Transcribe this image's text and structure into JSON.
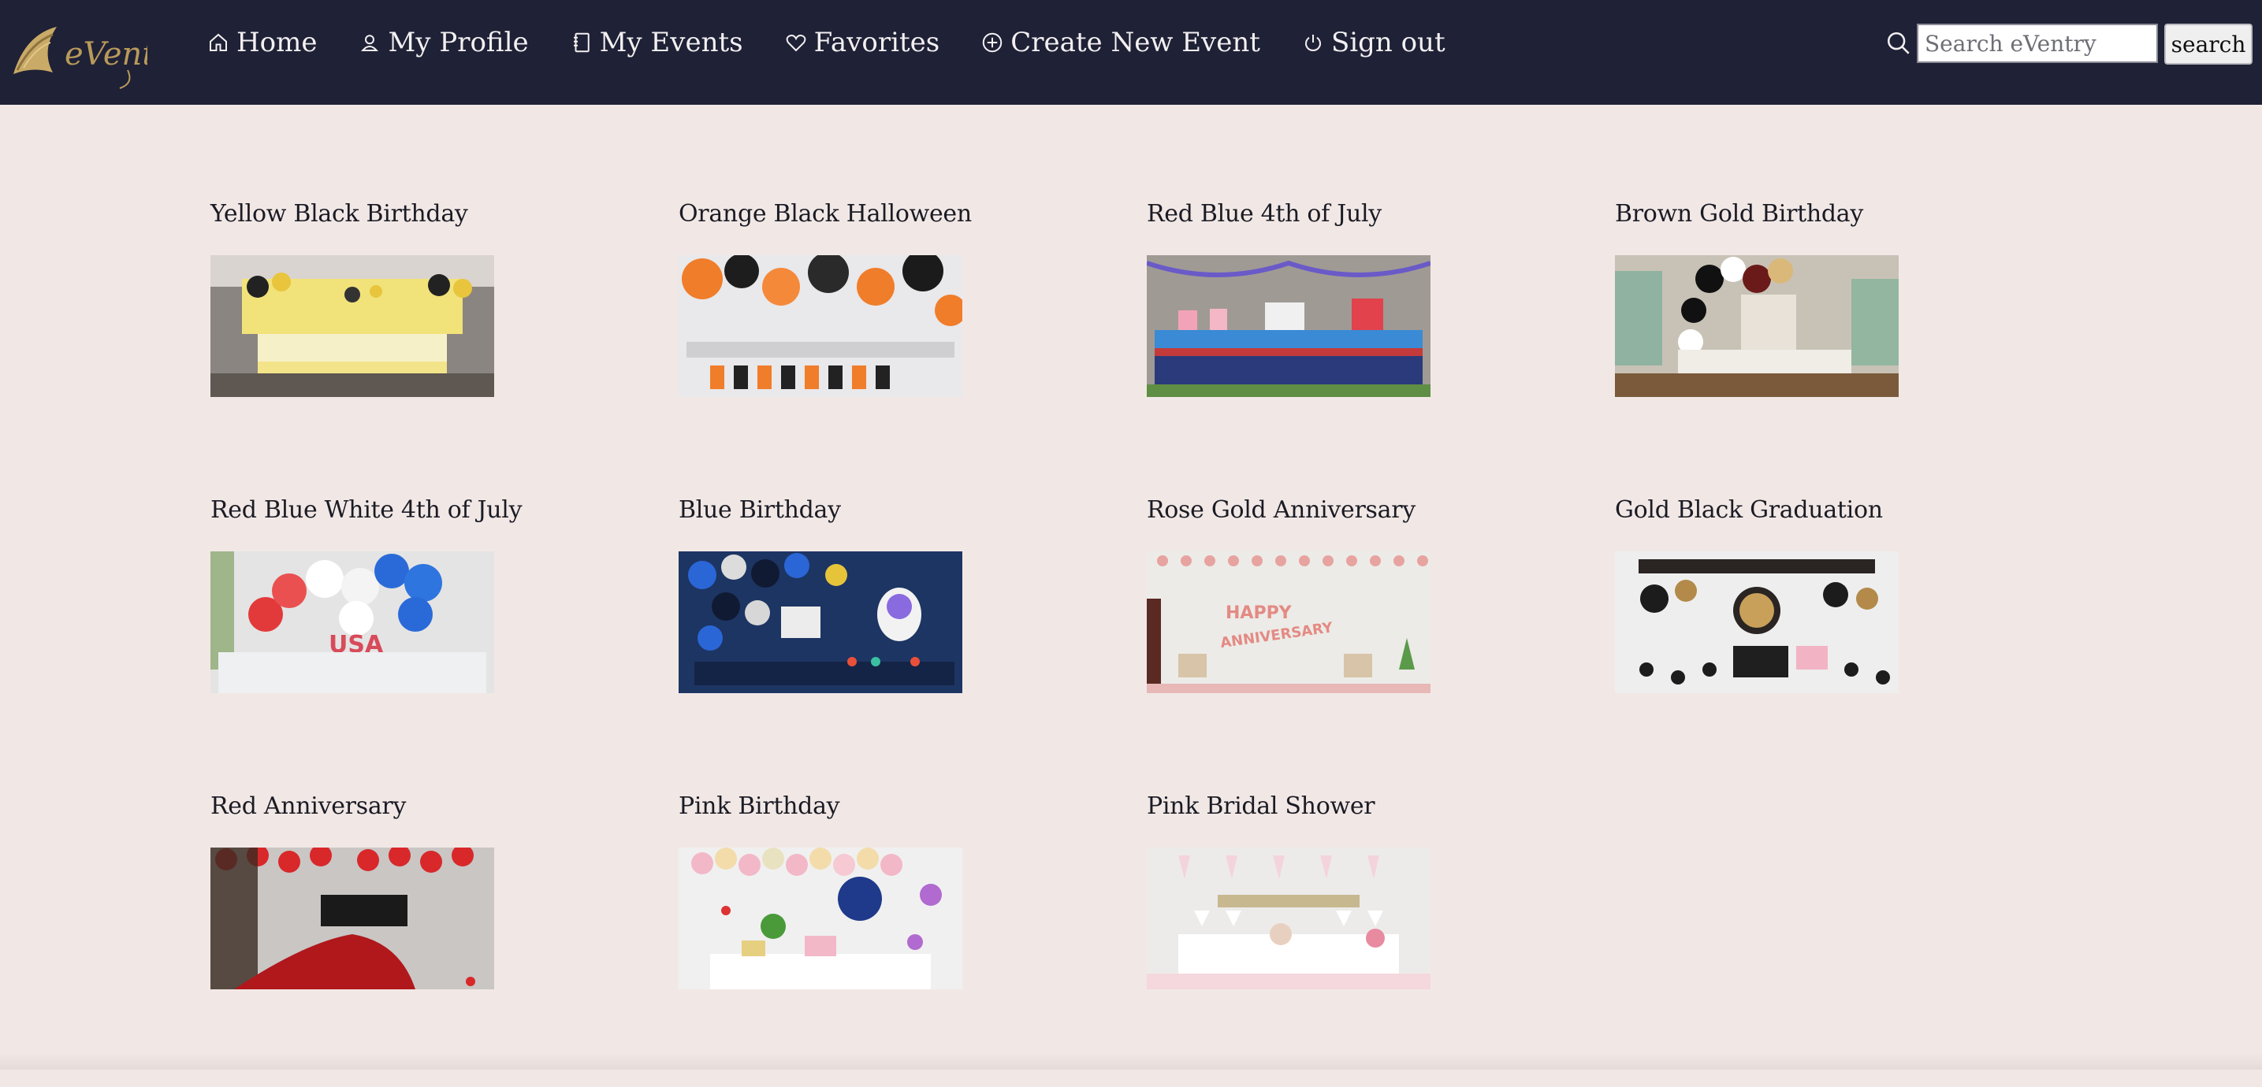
{
  "app": {
    "logo_text": "eVentry"
  },
  "nav": {
    "items": [
      {
        "label": "Home",
        "icon": "home-icon"
      },
      {
        "label": "My Profile",
        "icon": "user-icon"
      },
      {
        "label": "My Events",
        "icon": "notebook-icon"
      },
      {
        "label": "Favorites",
        "icon": "heart-icon"
      },
      {
        "label": "Create New Event",
        "icon": "plus-circle-icon"
      },
      {
        "label": "Sign out",
        "icon": "power-icon"
      }
    ]
  },
  "search": {
    "placeholder": "Search eVentry",
    "value": "",
    "button_label": "search",
    "icon": "search-icon"
  },
  "events": [
    {
      "title": "Yellow Black Birthday"
    },
    {
      "title": "Orange Black Halloween"
    },
    {
      "title": "Red Blue 4th of July"
    },
    {
      "title": "Brown Gold Birthday"
    },
    {
      "title": "Red Blue White 4th of July"
    },
    {
      "title": "Blue Birthday"
    },
    {
      "title": "Rose Gold Anniversary"
    },
    {
      "title": "Gold Black Graduation"
    },
    {
      "title": "Red Anniversary"
    },
    {
      "title": "Pink Birthday"
    },
    {
      "title": "Pink Bridal Shower"
    }
  ],
  "colors": {
    "navbar_bg": "#1f2136",
    "page_bg": "#f1e8e6",
    "logo_gold": "#b89a5a"
  }
}
